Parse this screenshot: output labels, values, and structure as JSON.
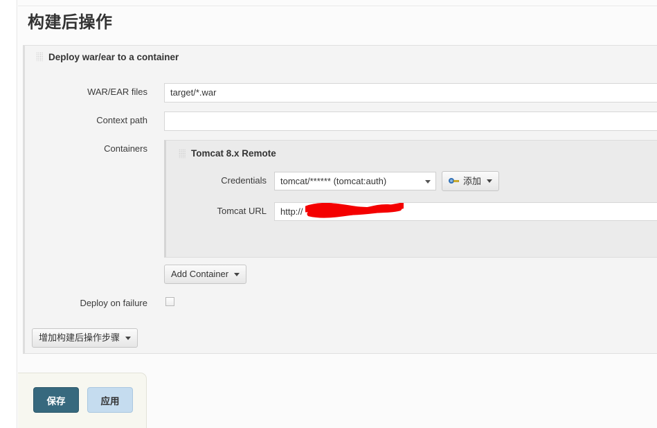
{
  "page": {
    "section_title": "构建后操作"
  },
  "postbuild": {
    "block_title": "Deploy war/ear to a container",
    "fields": {
      "war_files": {
        "label": "WAR/EAR files",
        "value": "target/*.war",
        "placeholder": ""
      },
      "context_path": {
        "label": "Context path",
        "value": "",
        "placeholder": ""
      },
      "containers": {
        "label": "Containers"
      },
      "deploy_on_failure": {
        "label": "Deploy on failure",
        "checked": false
      }
    },
    "container": {
      "title": "Tomcat 8.x Remote",
      "credentials": {
        "label": "Credentials",
        "selected": "tomcat/****** (tomcat:auth)"
      },
      "tomcat_url": {
        "label": "Tomcat URL",
        "value": "http://",
        "redacted": true
      },
      "add_credentials_button": "添加",
      "add_container_button": "Add Container"
    },
    "add_step_button": "增加构建后操作步骤"
  },
  "footer": {
    "save_button": "保存",
    "apply_button": "应用"
  },
  "colors": {
    "save_button_bg": "#37697e",
    "apply_button_bg": "#c5dcef",
    "panel_bg": "#f4f4f4",
    "container_panel_bg": "#ebebeb",
    "save_bar_bg": "#f7f7f0",
    "redaction": "#f40000"
  }
}
